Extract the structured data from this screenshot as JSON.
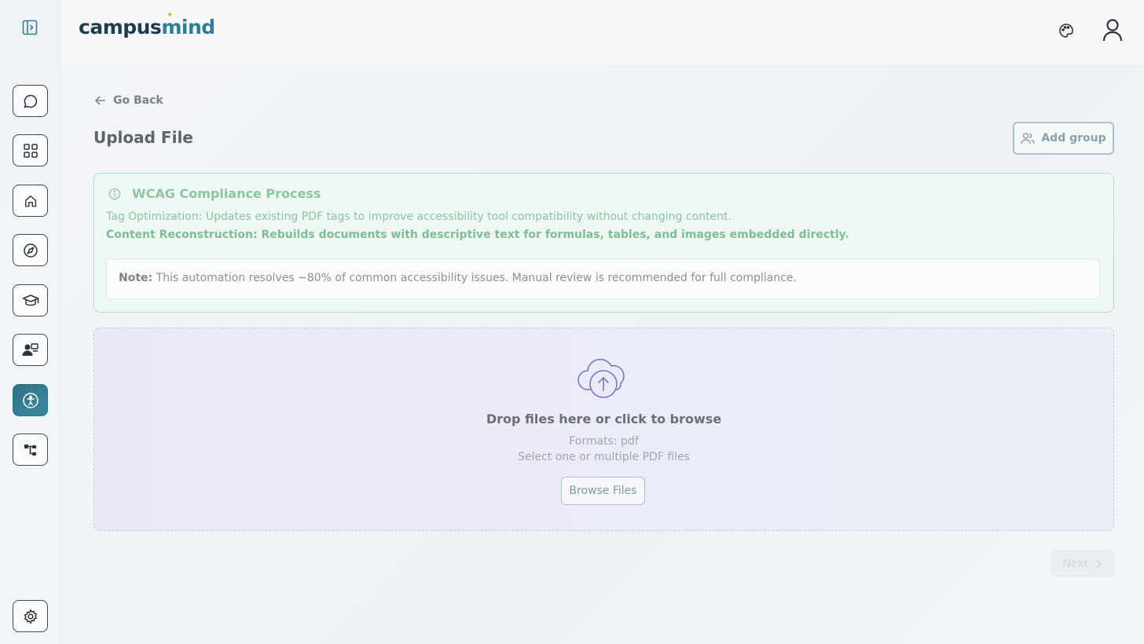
{
  "brand": {
    "part1": "campus",
    "part2": "mind"
  },
  "sidebar": {
    "toggle_icon": "sidebar-toggle-icon",
    "items": [
      {
        "name": "chat",
        "icon": "chat-bubble-icon"
      },
      {
        "name": "apps",
        "icon": "grid-icon"
      },
      {
        "name": "home",
        "icon": "home-icon"
      },
      {
        "name": "explore",
        "icon": "compass-icon"
      },
      {
        "name": "courses",
        "icon": "graduation-cap-icon"
      },
      {
        "name": "teaching",
        "icon": "teacher-icon"
      },
      {
        "name": "accessibility",
        "icon": "accessibility-icon",
        "active": true
      },
      {
        "name": "workflows",
        "icon": "flow-icon"
      }
    ],
    "settings_icon": "gear-icon"
  },
  "header": {
    "theme_icon": "palette-icon",
    "profile_icon": "user-icon"
  },
  "page": {
    "go_back": "Go Back",
    "title": "Upload File",
    "add_group": "Add group"
  },
  "wcag": {
    "title": "WCAG Compliance Process",
    "line1": "Tag Optimization: Updates existing PDF tags to improve accessibility tool compatibility without changing content.",
    "line2": "Content Reconstruction: Rebuilds documents with descriptive text for formulas, tables, and images embedded directly.",
    "note_label": "Note:",
    "note_text": " This automation resolves ~80% of common accessibility issues. Manual review is recommended for full compliance."
  },
  "upload": {
    "title": "Drop files here or click to browse",
    "formats": "Formats: pdf",
    "hint": "Select one or multiple PDF files",
    "browse": "Browse Files"
  },
  "footer": {
    "next": "Next"
  },
  "colors": {
    "accent": "#2f7185",
    "success": "#8dc4a4",
    "dropzone": "#eaecf7"
  }
}
